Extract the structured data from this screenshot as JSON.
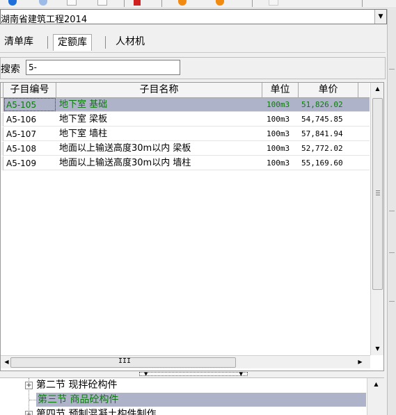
{
  "library": {
    "selected": "湖南省建筑工程2014"
  },
  "tabs": [
    {
      "label": "清单库"
    },
    {
      "label": "定额库"
    },
    {
      "label": "人材机"
    }
  ],
  "search": {
    "label": "搜索",
    "value": "5-"
  },
  "grid": {
    "headers": {
      "code": "子目编号",
      "name": "子目名称",
      "unit": "单位",
      "price": "单价"
    },
    "rows": [
      {
        "code": "A5-105",
        "name": "地下室 基础",
        "unit": "100m3",
        "price": "51,826.02"
      },
      {
        "code": "A5-106",
        "name": "地下室 梁板",
        "unit": "100m3",
        "price": "54,745.85"
      },
      {
        "code": "A5-107",
        "name": "地下室 墙柱",
        "unit": "100m3",
        "price": "57,841.94"
      },
      {
        "code": "A5-108",
        "name": "地面以上输送高度30m以内 梁板",
        "unit": "100m3",
        "price": "52,772.02"
      },
      {
        "code": "A5-109",
        "name": "地面以上输送高度30m以内 墙柱",
        "unit": "100m3",
        "price": "55,169.60"
      }
    ],
    "hscroll_grip": "III"
  },
  "tree": {
    "items": [
      {
        "label": "第二节  现拌砼构件"
      },
      {
        "label": "第三节  商品砼构件"
      },
      {
        "label": "第四节  预制混凝土构件制作"
      }
    ]
  },
  "colors": {
    "selection": "#aeb3ca",
    "selected_text": "#0a7a0a"
  }
}
